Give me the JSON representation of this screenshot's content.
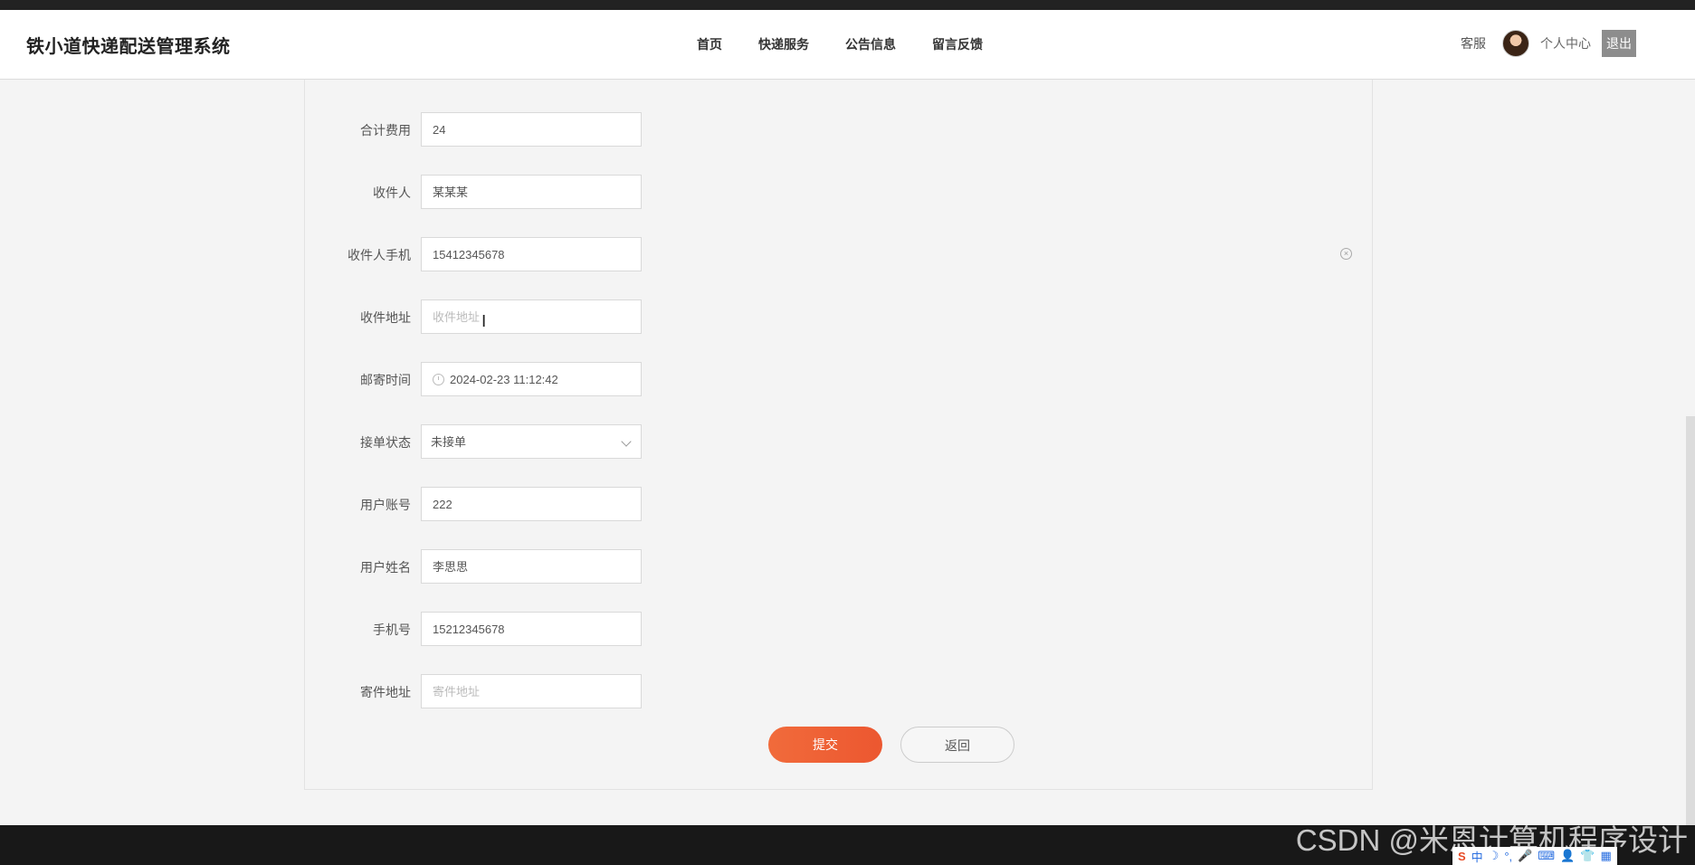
{
  "header": {
    "title": "铁小道快递配送管理系统",
    "nav": [
      "首页",
      "快递服务",
      "公告信息",
      "留言反馈"
    ],
    "service": "客服",
    "personal_center": "个人中心",
    "logout": "退出"
  },
  "form": {
    "total_fee": {
      "label": "合计费用",
      "value": "24"
    },
    "recipient": {
      "label": "收件人",
      "value": "某某某"
    },
    "recipient_phone": {
      "label": "收件人手机",
      "value": "15412345678"
    },
    "recipient_address": {
      "label": "收件地址",
      "placeholder": "收件地址"
    },
    "mail_time": {
      "label": "邮寄时间",
      "value": "2024-02-23 11:12:42"
    },
    "order_status": {
      "label": "接单状态",
      "value": "未接单"
    },
    "user_account": {
      "label": "用户账号",
      "value": "222"
    },
    "user_name": {
      "label": "用户姓名",
      "value": "李思思"
    },
    "phone": {
      "label": "手机号",
      "value": "15212345678"
    },
    "sender_address": {
      "label": "寄件地址",
      "placeholder": "寄件地址"
    }
  },
  "actions": {
    "submit": "提交",
    "back": "返回"
  },
  "watermark": "CSDN @米恩计算机程序设计",
  "ime": [
    "S",
    "中",
    "☽",
    "°,",
    "🎤",
    "⌨",
    "👤",
    "👕",
    "▦"
  ],
  "colors": {
    "accent": "#ec5730",
    "header_bg": "#ffffff",
    "page_bg": "#f4f4f4"
  }
}
